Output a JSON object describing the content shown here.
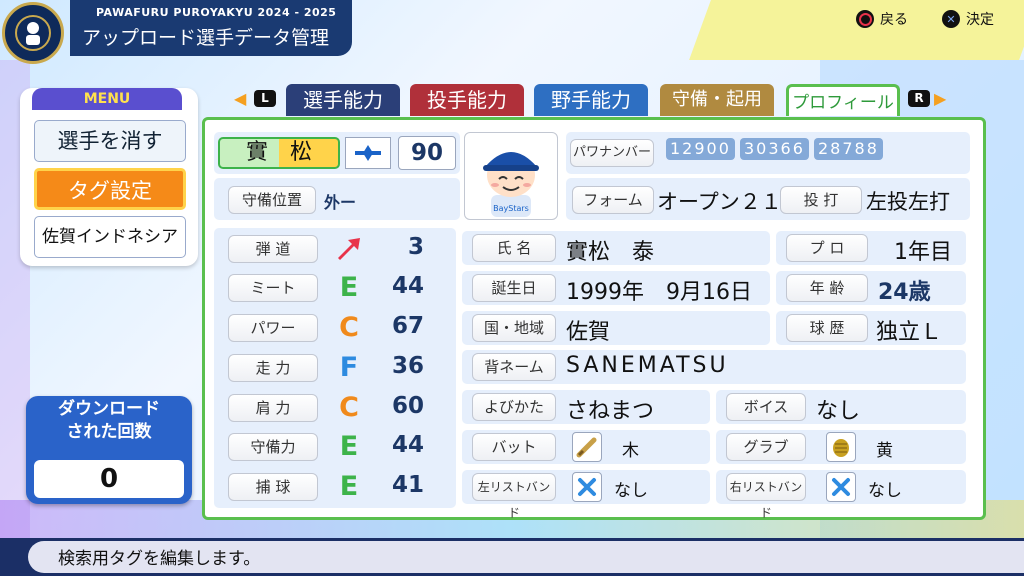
{
  "header": {
    "game_title": "PAWAFURU PUROYAKYU 2024 - 2025",
    "screen_title": "アップロード選手データ管理",
    "logo_icon": "team-logo-icon",
    "hints": [
      {
        "icon": "circle-button-icon",
        "label": "戻る"
      },
      {
        "icon": "cross-button-icon",
        "label": "決定"
      }
    ]
  },
  "tabs": {
    "left_shoulder": "L",
    "right_shoulder": "R",
    "items": [
      {
        "label": "選手能力",
        "active": false
      },
      {
        "label": "投手能力",
        "active": false
      },
      {
        "label": "野手能力",
        "active": false
      },
      {
        "label": "守備・起用",
        "active": false
      },
      {
        "label": "プロフィール",
        "active": true
      }
    ]
  },
  "menu": {
    "title": "MENU",
    "items": [
      "選手を消す",
      "タグ設定",
      "佐賀インドネシア"
    ]
  },
  "download": {
    "label_line1": "ダウンロード",
    "label_line2": "された回数",
    "count": "0"
  },
  "player": {
    "name_short": "實　松",
    "team_icon": "team-emblem-icon",
    "number": "90",
    "position_label": "守備位置",
    "position_value": "外ー",
    "pawa_number_label": "パワナンバー",
    "pawa_numbers": [
      "12900",
      "30366",
      "28788"
    ],
    "form_label": "フォーム",
    "form_value": "オープン２１",
    "throw_bat_label": "投 打",
    "throw_bat_value": "左投左打"
  },
  "abilities": [
    {
      "label": "弾 道",
      "rank": "",
      "icon": "trajectory-arrow-icon",
      "value": "3"
    },
    {
      "label": "ミート",
      "rank": "E",
      "value": "44"
    },
    {
      "label": "パワー",
      "rank": "C",
      "value": "67"
    },
    {
      "label": "走 力",
      "rank": "F",
      "value": "36"
    },
    {
      "label": "肩 力",
      "rank": "C",
      "value": "60"
    },
    {
      "label": "守備力",
      "rank": "E",
      "value": "44"
    },
    {
      "label": "捕 球",
      "rank": "E",
      "value": "41"
    }
  ],
  "profile": {
    "name": {
      "label": "氏 名",
      "value": "實松　泰"
    },
    "pro": {
      "label": "プ ロ",
      "value": "1年目"
    },
    "birthday": {
      "label": "誕生日",
      "value": "1999年　9月16日"
    },
    "age": {
      "label": "年 齢",
      "value": "24歳"
    },
    "region": {
      "label": "国・地域",
      "value": "佐賀"
    },
    "career": {
      "label": "球 歴",
      "value": "独立Ｌ"
    },
    "back_name": {
      "label": "背ネーム",
      "value": "SANEMATSU"
    },
    "reading": {
      "label": "よびかた",
      "value": "さねまつ"
    },
    "voice": {
      "label": "ボイス",
      "value": "なし"
    },
    "bat": {
      "label": "バット",
      "icon": "bat-icon",
      "value": "木"
    },
    "glove": {
      "label": "グラブ",
      "icon": "glove-icon",
      "value": "黄"
    },
    "left_wristband": {
      "label": "左リストバンド",
      "icon": "x-mark-icon",
      "value": "なし"
    },
    "right_wristband": {
      "label": "右リストバンド",
      "icon": "x-mark-icon",
      "value": "なし"
    }
  },
  "status_message": "検索用タグを編集します。",
  "colors": {
    "rank_E": "#3db34a",
    "rank_C": "#f08a1c",
    "rank_F": "#2e8be0",
    "panel_border": "#5abf4e",
    "tab_active": "#2e9a3a"
  }
}
